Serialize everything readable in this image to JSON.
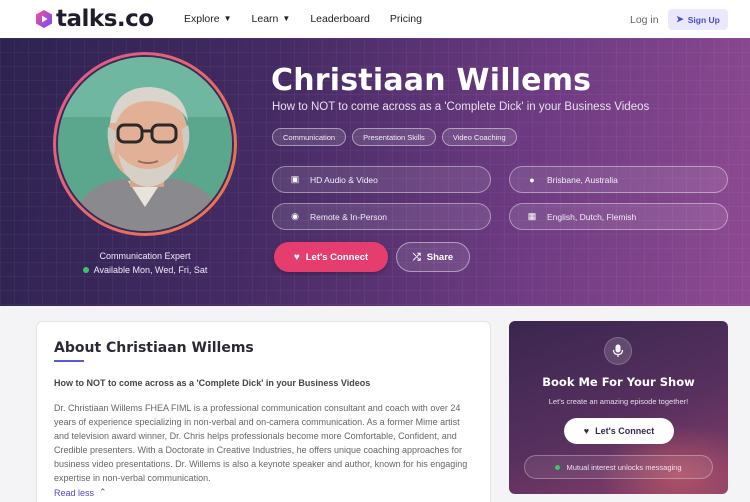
{
  "nav": {
    "logo_text": "talks.co",
    "links": [
      {
        "label": "Explore",
        "has_dropdown": true
      },
      {
        "label": "Learn",
        "has_dropdown": true
      },
      {
        "label": "Leaderboard",
        "has_dropdown": false
      },
      {
        "label": "Pricing",
        "has_dropdown": false
      }
    ],
    "login_label": "Log in",
    "signup_label": "Sign Up"
  },
  "hero": {
    "name": "Christiaan Willems",
    "subtitle": "How to NOT to come across as a 'Complete Dick' in your Business Videos",
    "role": "Communication Expert",
    "availability": "Available Mon, Wed, Fri, Sat",
    "tags": [
      "Communication",
      "Presentation Skills",
      "Video Coaching"
    ],
    "info": {
      "media": "HD Audio & Video",
      "location": "Brisbane, Australia",
      "format": "Remote & In-Person",
      "languages": "English, Dutch, Flemish"
    },
    "connect_label": "Let's Connect",
    "share_label": "Share"
  },
  "about": {
    "title": "About Christiaan Willems",
    "subtitle": "How to NOT to come across as a 'Complete Dick' in your Business Videos",
    "body": "Dr. Christiaan Willems FHEA FIML is a professional communication consultant and coach with over 24 years of experience specializing in non-verbal and on-camera communication. As a former Mime artist and television award winner, Dr. Chris helps professionals become more Comfortable, Confident, and Credible presenters. With a Doctorate in Creative Industries, he offers unique coaching approaches for business video presentations. Dr. Willems is also a keynote speaker and author, known for his engaging expertise in non-verbal communication.",
    "read_less_label": "Read less"
  },
  "book": {
    "title": "Book Me For Your Show",
    "subtitle": "Let's create an amazing episode together!",
    "button_label": "Let's Connect",
    "note": "Mutual interest unlocks messaging"
  },
  "colors": {
    "accent": "#e43d6e",
    "link": "#4a4ad0",
    "available": "#3cc46b"
  }
}
